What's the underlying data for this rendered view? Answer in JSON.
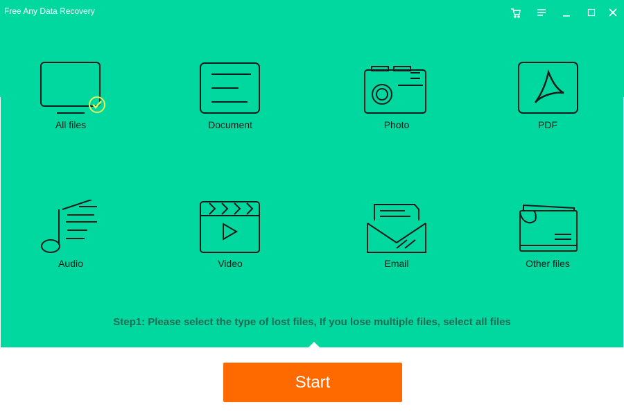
{
  "window": {
    "title": "Free Any Data Recovery"
  },
  "titlebar": {
    "buttons": [
      {
        "icon": "cart-icon"
      },
      {
        "icon": "menu-icon"
      },
      {
        "icon": "minimize-icon"
      },
      {
        "icon": "maximize-icon"
      },
      {
        "icon": "close-icon"
      }
    ]
  },
  "file_types": [
    {
      "label": "All files",
      "icon": "monitor-icon",
      "selected": true
    },
    {
      "label": "Document",
      "icon": "document-icon",
      "selected": false
    },
    {
      "label": "Photo",
      "icon": "camera-icon",
      "selected": false
    },
    {
      "label": "PDF",
      "icon": "pdf-icon",
      "selected": false
    },
    {
      "label": "Audio",
      "icon": "music-note-icon",
      "selected": false
    },
    {
      "label": "Video",
      "icon": "clapperboard-icon",
      "selected": false
    },
    {
      "label": "Email",
      "icon": "envelope-icon",
      "selected": false
    },
    {
      "label": "Other files",
      "icon": "folder-icon",
      "selected": false
    }
  ],
  "instruction": "Step1: Please select the type of lost files, If you lose multiple files, select all files",
  "start_button": {
    "label": "Start"
  },
  "colors": {
    "accent": "#00d8a0",
    "start": "#ff6a00",
    "check": "#e8f55a",
    "instruction": "#1d6b52"
  }
}
